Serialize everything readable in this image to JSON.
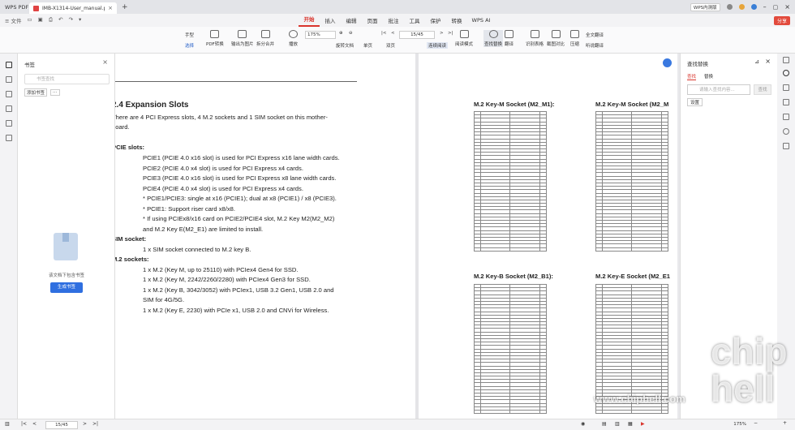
{
  "titlebar": {
    "app_name": "WPS PDF",
    "tab_title": "IMB-X1314-User_manual.p",
    "tab_close": "×",
    "add_tab": "+",
    "badge": "WPS内测版"
  },
  "menubar": {
    "file": "≡ 文件",
    "menus": [
      "开始",
      "插入",
      "编辑",
      "页面",
      "批注",
      "工具",
      "保护",
      "转换",
      "WPS AI"
    ],
    "share": "分享"
  },
  "toolbar": {
    "hand": "手型",
    "select": "选择",
    "pdf_convert": "PDF转换",
    "to_image": "输出为图片",
    "split_merge": "拆分合并",
    "play": "播放",
    "zoom": "175%",
    "rotate": "旋转文档",
    "single": "单页",
    "double": "双页",
    "continuous": "连续阅读",
    "read_mode": "阅读模式",
    "page": "15/45",
    "find_replace": "查找替换",
    "translate": "翻译",
    "ocr": "识别表格",
    "screenshot": "截图对比",
    "compress": "压缩",
    "full_translate": "全文翻译",
    "listen": "听说翻译"
  },
  "bookmark_panel": {
    "title": "书签",
    "search_placeholder": "书签查找",
    "add": "添加书签",
    "empty_text": "该文档下包含书签",
    "create": "生成书签"
  },
  "page1": {
    "heading": "2.4 Expansion Slots",
    "intro1": "There are 4 PCI Express slots, 4 M.2 sockets and 1 SIM socket on this mother-",
    "intro2": "board.",
    "pcie_heading": "PCIE slots:",
    "pcie_lines": [
      "PCIE1 (PCIE 4.0 x16 slot) is used for PCI Express x16 lane width cards.",
      "PCIE2 (PCIE 4.0 x4 slot) is used for PCI Express x4 cards.",
      "PCIE3 (PCIE 4.0 x16 slot) is used for PCI Express x8 lane width cards.",
      "PCIE4 (PCIE 4.0 x4 slot) is used for PCI Express x4 cards.",
      "* PCIE1/PCIE3: single at x16 (PCIE1); dual at x8 (PCIE1) / x8 (PCIE3).",
      "* PCIE1: Support riser card x8/x8.",
      "* If using PCIEx8/x16 card on PCIE2/PCIE4 slot, M.2 Key M2(M2_M2)",
      "and M.2 Key E(M2_E1) are limited to install."
    ],
    "sim_heading": "SIM socket:",
    "sim_line": "1 x SIM socket connected to M.2 key B.",
    "m2_heading": "M.2 sockets:",
    "m2_lines": [
      "1 x M.2 (Key M, up to 25110) with PCIex4 Gen4 for SSD.",
      "1 x M.2 (Key M, 2242/2260/2280) with PCIex4 Gen3 for SSD.",
      "1 x M.2 (Key B, 3042/3052) with PCIex1, USB 3.2 Gen1, USB 2.0 and",
      "SIM for 4G/5G.",
      "1 x M.2 (Key E, 2230) with PCIe x1, USB 2.0 and CNVi for Wireless."
    ]
  },
  "page2": {
    "t1": "M.2 Key-M Socket (M2_M1):",
    "t2": "M.2 Key-M Socket (M2_M",
    "t3": "M.2 Key-B Socket (M2_B1):",
    "t4": "M.2 Key-E Socket (M2_E1"
  },
  "right_panel": {
    "title": "查找替换",
    "tab_find": "查找",
    "tab_replace": "替换",
    "input_placeholder": "请输入查找内容...",
    "search_btn": "查找",
    "settings": "设置"
  },
  "statusbar": {
    "page": "15/45",
    "zoom": "175%"
  },
  "watermark": {
    "url": "www.chiphell.com",
    "logo": "chip hell"
  }
}
